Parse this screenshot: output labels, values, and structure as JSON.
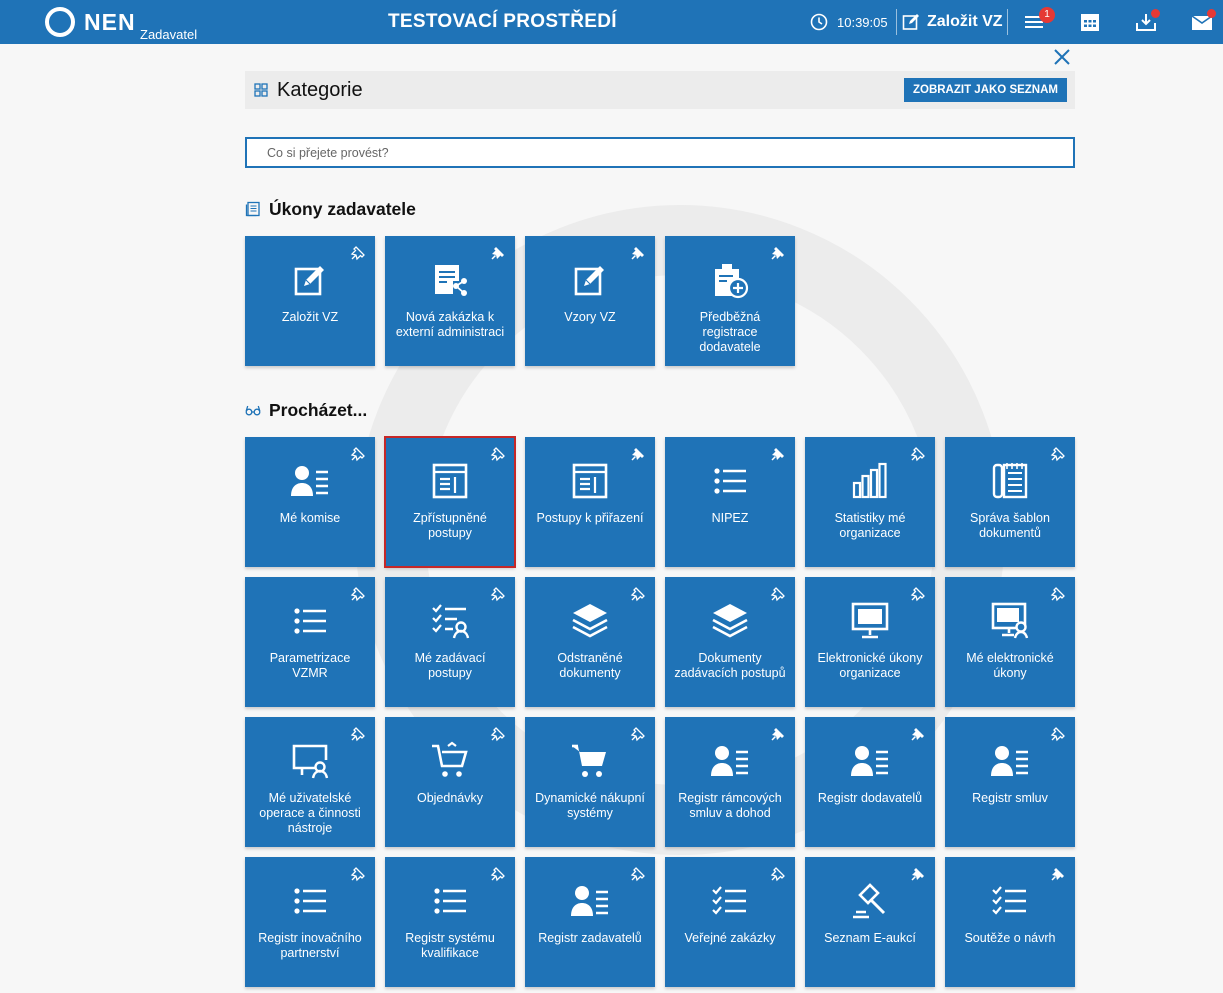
{
  "header": {
    "logo_text": "NEN",
    "logo_sub": "Zadavatel",
    "env_title": "TESTOVACÍ PROSTŘEDÍ",
    "clock": "10:39:05",
    "new_vz_label": "Založit VZ",
    "notifications_count": "1"
  },
  "category": {
    "title": "Kategorie",
    "list_button": "ZOBRAZIT JAKO SEZNAM"
  },
  "search": {
    "placeholder": "Co si přejete provést?",
    "value": ""
  },
  "sections": [
    {
      "title": "Úkony zadavatele",
      "tiles": [
        {
          "label": "Založit VZ",
          "icon": "edit-icon",
          "pinned": false
        },
        {
          "label": "Nová zakázka k externí administraci",
          "icon": "document-share-icon",
          "pinned": true
        },
        {
          "label": "Vzory VZ",
          "icon": "edit-icon",
          "pinned": true
        },
        {
          "label": "Předběžná registrace dodavatele",
          "icon": "clipboard-add-icon",
          "pinned": true
        }
      ]
    },
    {
      "title": "Procházet...",
      "tiles": [
        {
          "label": "Mé komise",
          "icon": "user-list-icon",
          "pinned": false
        },
        {
          "label": "Zpřístupněné postupy",
          "icon": "window-list-icon",
          "pinned": false,
          "selected": true
        },
        {
          "label": "Postupy k přiřazení",
          "icon": "window-list-icon",
          "pinned": true
        },
        {
          "label": "NIPEZ",
          "icon": "list-icon",
          "pinned": true
        },
        {
          "label": "Statistiky mé organizace",
          "icon": "bar-chart-icon",
          "pinned": false
        },
        {
          "label": "Správa šablon dokumentů",
          "icon": "binder-icon",
          "pinned": false
        },
        {
          "label": "Parametrizace VZMR",
          "icon": "list-icon",
          "pinned": false
        },
        {
          "label": "Mé zadávací postupy",
          "icon": "checklist-user-icon",
          "pinned": false
        },
        {
          "label": "Odstraněné dokumenty",
          "icon": "layers-icon",
          "pinned": false
        },
        {
          "label": "Dokumenty zadávacích postupů",
          "icon": "layers-icon",
          "pinned": false
        },
        {
          "label": "Elektronické úkony organizace",
          "icon": "monitor-icon",
          "pinned": false
        },
        {
          "label": "Mé elektronické úkony",
          "icon": "monitor-user-icon",
          "pinned": false
        },
        {
          "label": "Mé uživatelské operace a činnosti nástroje",
          "icon": "screen-user-icon",
          "pinned": false
        },
        {
          "label": "Objednávky",
          "icon": "cart-outline-icon",
          "pinned": false
        },
        {
          "label": "Dynamické nákupní systémy",
          "icon": "cart-icon",
          "pinned": false
        },
        {
          "label": "Registr rámcových smluv a dohod",
          "icon": "user-list-icon",
          "pinned": true
        },
        {
          "label": "Registr dodavatelů",
          "icon": "user-list-icon",
          "pinned": true
        },
        {
          "label": "Registr smluv",
          "icon": "user-list-icon",
          "pinned": false
        },
        {
          "label": "Registr inovačního partnerství",
          "icon": "list-icon",
          "pinned": false
        },
        {
          "label": "Registr systému kvalifikace",
          "icon": "list-icon",
          "pinned": false
        },
        {
          "label": "Registr zadavatelů",
          "icon": "user-list-icon",
          "pinned": false
        },
        {
          "label": "Veřejné zakázky",
          "icon": "checklist-icon",
          "pinned": false
        },
        {
          "label": "Seznam E-aukcí",
          "icon": "gavel-icon",
          "pinned": true
        },
        {
          "label": "Soutěže o návrh",
          "icon": "checklist-icon",
          "pinned": true
        }
      ]
    }
  ],
  "colors": {
    "brand": "#1f73b7",
    "badge": "#e53935",
    "selected_border": "#c62828"
  }
}
